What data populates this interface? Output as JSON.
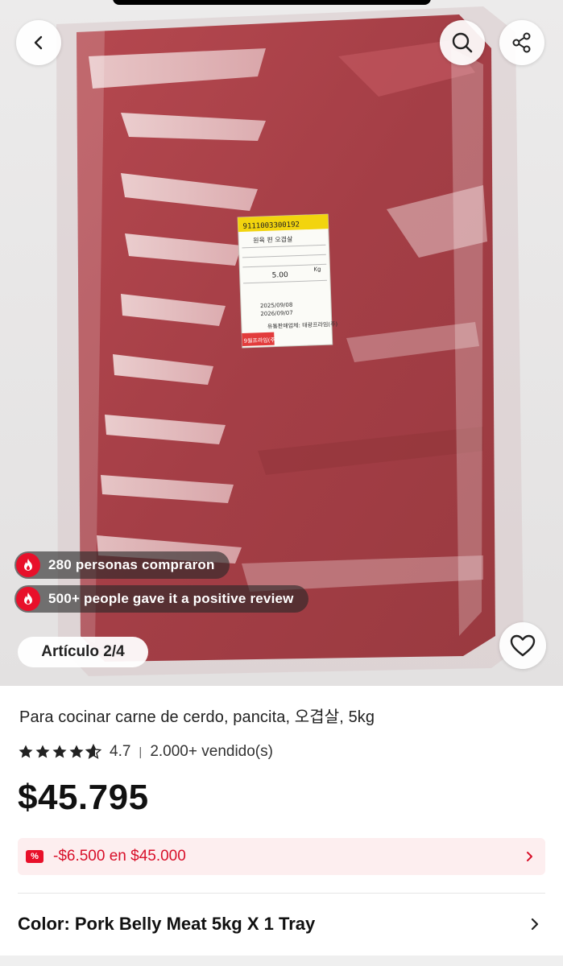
{
  "hero": {
    "label_product_code": "9111003300192",
    "label_line1": "원육 편 오겹살",
    "label_weight": "5.00",
    "label_unit": "Kg",
    "label_date1": "2025/09/08",
    "label_date2": "2026/09/07",
    "label_company": "유통판매업체: 태광프라임(주)",
    "label_footer": "9월프라임(주)",
    "social_proof": [
      {
        "text": "280 personas compraron"
      },
      {
        "text": "500+ people gave it a positive review"
      }
    ],
    "article_counter": "Artículo 2/4"
  },
  "icons": {
    "back": "chevron-left-icon",
    "search": "search-icon",
    "share": "share-icon",
    "favorite": "heart-icon",
    "fire": "fire-icon",
    "coupon": "coupon-icon",
    "chevron": "chevron-right-icon"
  },
  "product": {
    "title": "Para cocinar carne de cerdo, pancita, 오겹살, 5kg",
    "rating": 4.7,
    "rating_text": "4.7",
    "sold": "2.000+ vendido(s)",
    "price": "$45.795",
    "coupon_text": "-$6.500 en $45.000",
    "color_label": "Color: Pork Belly Meat 5kg X 1 Tray"
  },
  "colors": {
    "accent_red": "#e8102a",
    "coupon_bg": "#fdeeef",
    "coupon_text": "#d8102a"
  }
}
